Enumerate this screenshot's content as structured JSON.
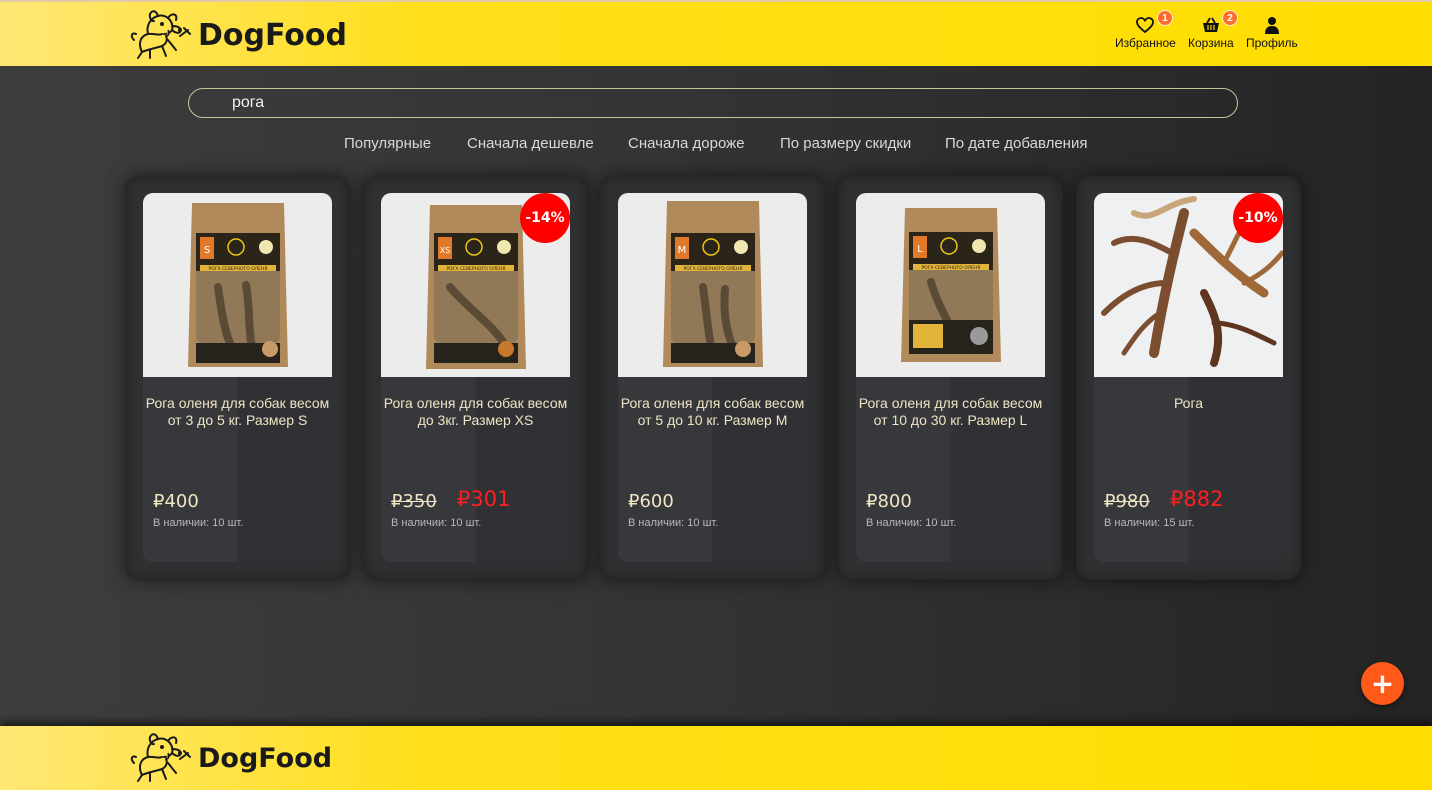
{
  "brand": {
    "name": "DogFood"
  },
  "nav": {
    "favorites": {
      "label": "Избранное",
      "count": "1",
      "icon": "heart-icon"
    },
    "cart": {
      "label": "Корзина",
      "count": "2",
      "icon": "basket-icon"
    },
    "profile": {
      "label": "Профиль",
      "icon": "user-icon"
    }
  },
  "search": {
    "value": "рога",
    "placeholder": ""
  },
  "sort": [
    "Популярные",
    "Сначала дешевле",
    "Сначала дороже",
    "По размеру скидки",
    "По дате добавления"
  ],
  "products": [
    {
      "title": "Рога оленя для собак весом от 3 до 5 кг. Размер S",
      "size_letter": "S",
      "price": "₽400",
      "old_price": "",
      "discount": "",
      "stock": "В наличии: 10 шт."
    },
    {
      "title": "Рога оленя для собак весом до 3кг. Размер XS",
      "size_letter": "XS",
      "price": "₽301",
      "old_price": "₽350",
      "discount": "-14%",
      "stock": "В наличии: 10 шт."
    },
    {
      "title": "Рога оленя для собак весом от 5 до 10 кг. Размер M",
      "size_letter": "M",
      "price": "₽600",
      "old_price": "",
      "discount": "",
      "stock": "В наличии: 10 шт."
    },
    {
      "title": "Рога оленя для собак весом от 10 до 30 кг. Размер L",
      "size_letter": "L",
      "price": "₽800",
      "old_price": "",
      "discount": "",
      "stock": "В наличии: 10 шт."
    },
    {
      "title": "Рога",
      "size_letter": "",
      "price": "₽882",
      "old_price": "₽980",
      "discount": "-10%",
      "stock": "В наличии: 15 шт."
    }
  ],
  "package_label": "РОГА СЕВЕРНОГО ОЛЕНЯ",
  "fab": {
    "label": "+"
  },
  "colors": {
    "brand_yellow": "#ffdd00",
    "discount_red": "#ff0000",
    "fab_orange": "#ff5a1a",
    "badge_orange": "#ff6d2e"
  }
}
